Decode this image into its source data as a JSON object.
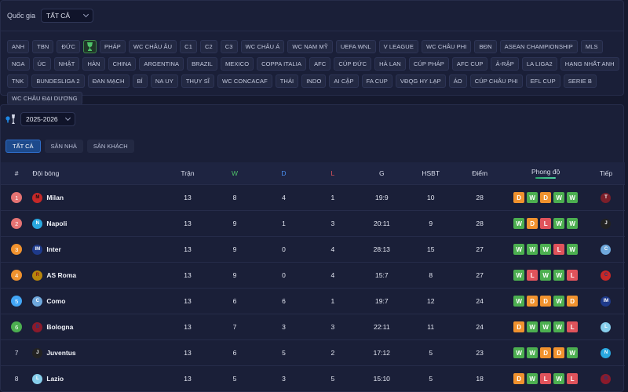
{
  "filters": {
    "country_label": "Quốc gia",
    "country_value": "TẤT CẢ"
  },
  "leagues": [
    "ANH",
    "TBN",
    "ĐỨC",
    "__icon__",
    "PHÁP",
    "WC CHÂU ÂU",
    "C1",
    "C2",
    "C3",
    "WC CHÂU Á",
    "WC NAM MỸ",
    "UEFA WNL",
    "V LEAGUE",
    "WC CHÂU PHI",
    "BĐN",
    "ASEAN CHAMPIONSHIP",
    "MLS",
    "NGA",
    "ÚC",
    "NHẬT",
    "HÀN",
    "CHINA",
    "ARGENTINA",
    "BRAZIL",
    "MEXICO",
    "COPPA ITALIA",
    "AFC",
    "CÚP ĐỨC",
    "HÀ LAN",
    "CÚP PHÁP",
    "AFC CUP",
    "Ả-RẬP",
    "LA LIGA2",
    "HẠNG NHẤT ANH",
    "TNK",
    "BUNDESLIGA 2",
    "ĐAN MẠCH",
    "BỈ",
    "NA UY",
    "THỤY SĨ",
    "WC CONCACAF",
    "THÁI",
    "INDO",
    "AI CẬP",
    "FA CUP",
    "VĐQG HY LẠP",
    "ÁO",
    "CÚP CHÂU PHI",
    "EFL CUP",
    "SERIE B",
    "WC CHÂU ĐẠI DƯƠNG"
  ],
  "season": {
    "value": "2025-2026"
  },
  "tabs": [
    "TẤT CẢ",
    "SÂN NHÀ",
    "SÂN KHÁCH"
  ],
  "table": {
    "headers": {
      "rank": "#",
      "team": "Đội bóng",
      "played": "Trận",
      "w": "W",
      "d": "D",
      "l": "L",
      "g": "G",
      "gd": "HSBT",
      "pts": "Điểm",
      "form": "Phong độ",
      "next": "Tiếp"
    },
    "rows": [
      {
        "rank": "1",
        "team": "Milan",
        "p": "13",
        "w": "8",
        "d": "4",
        "l": "1",
        "g": "19:9",
        "gd": "10",
        "pts": "28",
        "form": [
          "D",
          "W",
          "D",
          "W",
          "W"
        ],
        "logo": "milan",
        "next": "torino"
      },
      {
        "rank": "2",
        "team": "Napoli",
        "p": "13",
        "w": "9",
        "d": "1",
        "l": "3",
        "g": "20:11",
        "gd": "9",
        "pts": "28",
        "form": [
          "W",
          "D",
          "L",
          "W",
          "W"
        ],
        "logo": "napoli",
        "next": "juventus"
      },
      {
        "rank": "3",
        "team": "Inter",
        "p": "13",
        "w": "9",
        "d": "0",
        "l": "4",
        "g": "28:13",
        "gd": "15",
        "pts": "27",
        "form": [
          "W",
          "W",
          "W",
          "L",
          "W"
        ],
        "logo": "inter",
        "next": "como"
      },
      {
        "rank": "4",
        "team": "AS Roma",
        "p": "13",
        "w": "9",
        "d": "0",
        "l": "4",
        "g": "15:7",
        "gd": "8",
        "pts": "27",
        "form": [
          "W",
          "L",
          "W",
          "W",
          "L"
        ],
        "logo": "roma",
        "next": "cagliari"
      },
      {
        "rank": "5",
        "team": "Como",
        "p": "13",
        "w": "6",
        "d": "6",
        "l": "1",
        "g": "19:7",
        "gd": "12",
        "pts": "24",
        "form": [
          "W",
          "D",
          "D",
          "W",
          "D"
        ],
        "logo": "como",
        "next": "inter"
      },
      {
        "rank": "6",
        "team": "Bologna",
        "p": "13",
        "w": "7",
        "d": "3",
        "l": "3",
        "g": "22:11",
        "gd": "11",
        "pts": "24",
        "form": [
          "D",
          "W",
          "W",
          "W",
          "L"
        ],
        "logo": "bologna",
        "next": "lazio"
      },
      {
        "rank": "7",
        "team": "Juventus",
        "p": "13",
        "w": "6",
        "d": "5",
        "l": "2",
        "g": "17:12",
        "gd": "5",
        "pts": "23",
        "form": [
          "W",
          "W",
          "D",
          "D",
          "W"
        ],
        "logo": "juventus",
        "next": "napoli"
      },
      {
        "rank": "8",
        "team": "Lazio",
        "p": "13",
        "w": "5",
        "d": "3",
        "l": "5",
        "g": "15:10",
        "gd": "5",
        "pts": "18",
        "form": [
          "D",
          "W",
          "L",
          "W",
          "L"
        ],
        "logo": "lazio",
        "next": "bologna"
      }
    ]
  },
  "colors": {
    "form_W": "#4caf50",
    "form_D": "#f0922e",
    "form_L": "#e0535b",
    "rank_1": "#e57373",
    "rank_2": "#e57373",
    "rank_3": "#f0922e",
    "rank_4": "#f0922e",
    "rank_5": "#42a5f5",
    "rank_6": "#4caf50"
  },
  "team_logos": {
    "milan": {
      "bg": "#c62828",
      "fg": "#111111",
      "txt": "M"
    },
    "napoli": {
      "bg": "#29a8e0",
      "fg": "#ffffff",
      "txt": "N"
    },
    "inter": {
      "bg": "#1e3a8a",
      "fg": "#ffffff",
      "txt": "IM"
    },
    "roma": {
      "bg": "#b8860b",
      "fg": "#8b1a1a",
      "txt": "R"
    },
    "como": {
      "bg": "#6fa8dc",
      "fg": "#ffffff",
      "txt": "C"
    },
    "bologna": {
      "bg": "#8b1a2b",
      "fg": "#1f3b7a",
      "txt": "B"
    },
    "juventus": {
      "bg": "#222222",
      "fg": "#ffffff",
      "txt": "J"
    },
    "lazio": {
      "bg": "#87ceeb",
      "fg": "#ffffff",
      "txt": "L"
    },
    "torino": {
      "bg": "#7b1f2a",
      "fg": "#ffffff",
      "txt": "T"
    },
    "cagliari": {
      "bg": "#c62828",
      "fg": "#1f3b7a",
      "txt": "C"
    }
  }
}
